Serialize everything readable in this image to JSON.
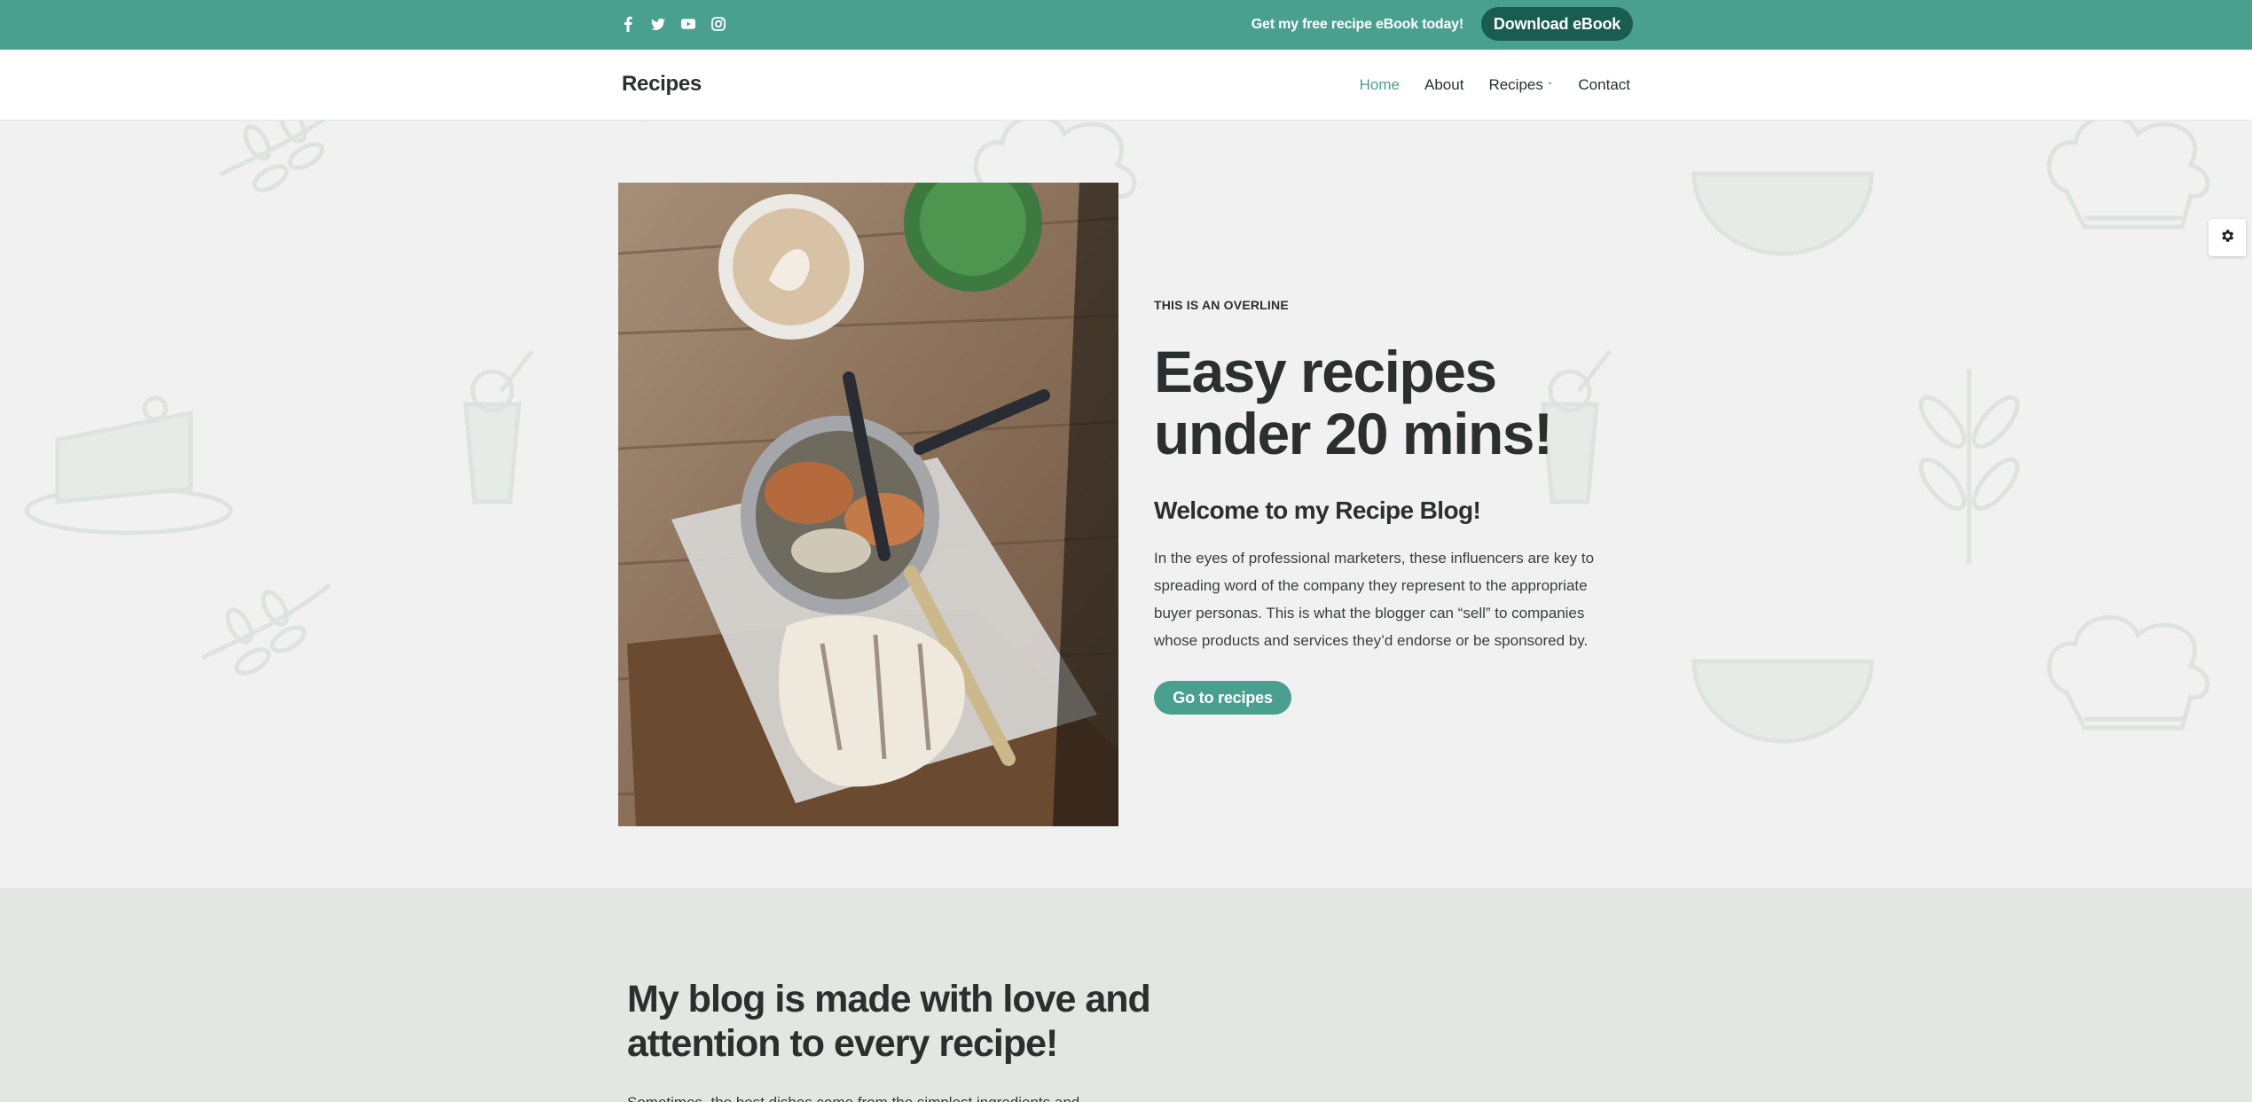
{
  "topbar": {
    "social_icons": [
      "facebook-icon",
      "twitter-icon",
      "youtube-icon",
      "instagram-icon"
    ],
    "promo_text": "Get my free recipe eBook today!",
    "download_label": "Download eBook"
  },
  "nav": {
    "brand": "Recipes",
    "items": [
      {
        "label": "Home",
        "active": true
      },
      {
        "label": "About",
        "active": false
      },
      {
        "label": "Recipes",
        "active": false,
        "dropdown": true
      },
      {
        "label": "Contact",
        "active": false
      }
    ]
  },
  "hero": {
    "overline": "THIS IS AN OVERLINE",
    "title": "Easy recipes under 20 mins!",
    "subtitle": "Welcome to my Recipe Blog!",
    "body": "In the eyes of professional marketers, these influencers are key to spreading word of the company they represent to the appropriate buyer personas. This is what the blogger can “sell” to companies whose products and services they’d endorse or be sponsored by.",
    "button_label": "Go to recipes"
  },
  "settings": {
    "icon": "gear-icon"
  },
  "lower": {
    "title": "My blog is made with love and attention to every recipe!",
    "body_cut": "Sometimes, the best dishes come from the simplest ingredients and"
  },
  "colors": {
    "accent": "#4aa08f",
    "accent_dark": "#185d4f",
    "hero_bg": "#f1f1f1",
    "lower_bg": "#e3e7e1",
    "text": "#2b2f2e"
  }
}
